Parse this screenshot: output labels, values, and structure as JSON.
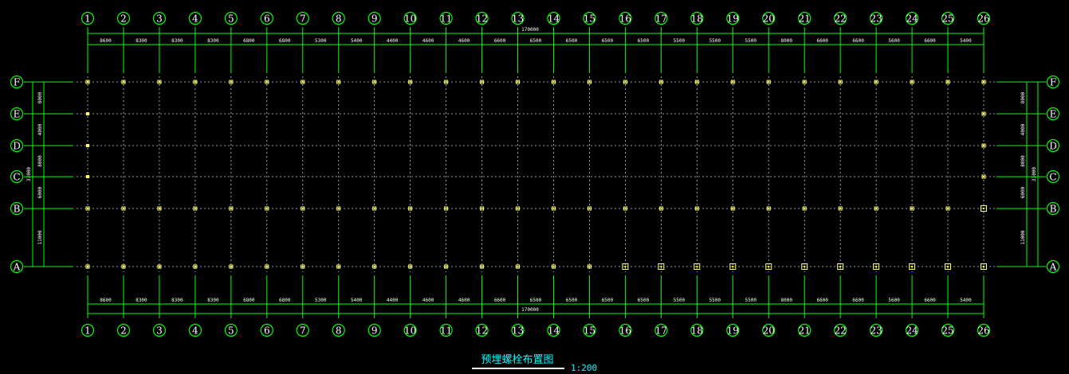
{
  "drawing": {
    "title": "预埋螺栓布置图",
    "scale": "1:200"
  },
  "grid": {
    "columns": [
      "1",
      "2",
      "3",
      "4",
      "5",
      "6",
      "7",
      "8",
      "9",
      "10",
      "11",
      "12",
      "13",
      "14",
      "15",
      "16",
      "17",
      "18",
      "19",
      "20",
      "21",
      "22",
      "23",
      "24",
      "25",
      "26"
    ],
    "rows": [
      "F",
      "E",
      "D",
      "C",
      "B",
      "A"
    ],
    "spacings_top": [
      "8600",
      "8300",
      "8300",
      "8300",
      "6800",
      "6800",
      "5300",
      "5400",
      "4400",
      "4600",
      "4600",
      "6600",
      "6500",
      "6500",
      "6500",
      "6500",
      "5500",
      "5500",
      "5500",
      "8000",
      "6600",
      "6600",
      "5600",
      "6600",
      "5400"
    ],
    "spacings_bottom": [
      "8600",
      "8300",
      "8300",
      "8300",
      "6800",
      "6800",
      "5300",
      "5400",
      "4400",
      "4600",
      "4600",
      "6600",
      "6500",
      "6500",
      "6500",
      "6500",
      "5500",
      "5500",
      "5500",
      "8000",
      "6600",
      "6600",
      "5600",
      "6600",
      "5400"
    ],
    "total_length": "170000",
    "row_spacings": [
      "8000",
      "4000",
      "8000",
      "6000",
      "11000"
    ],
    "total_width": "33000"
  },
  "colors": {
    "background": "#000000",
    "dimension_lines": "#00ff00",
    "axis_bubbles": "#00ff00",
    "axis_labels": "#ffffff",
    "grid_lines": "#c8c8c8",
    "bolt_markers": "#ffff66",
    "title": "#00ffff"
  }
}
